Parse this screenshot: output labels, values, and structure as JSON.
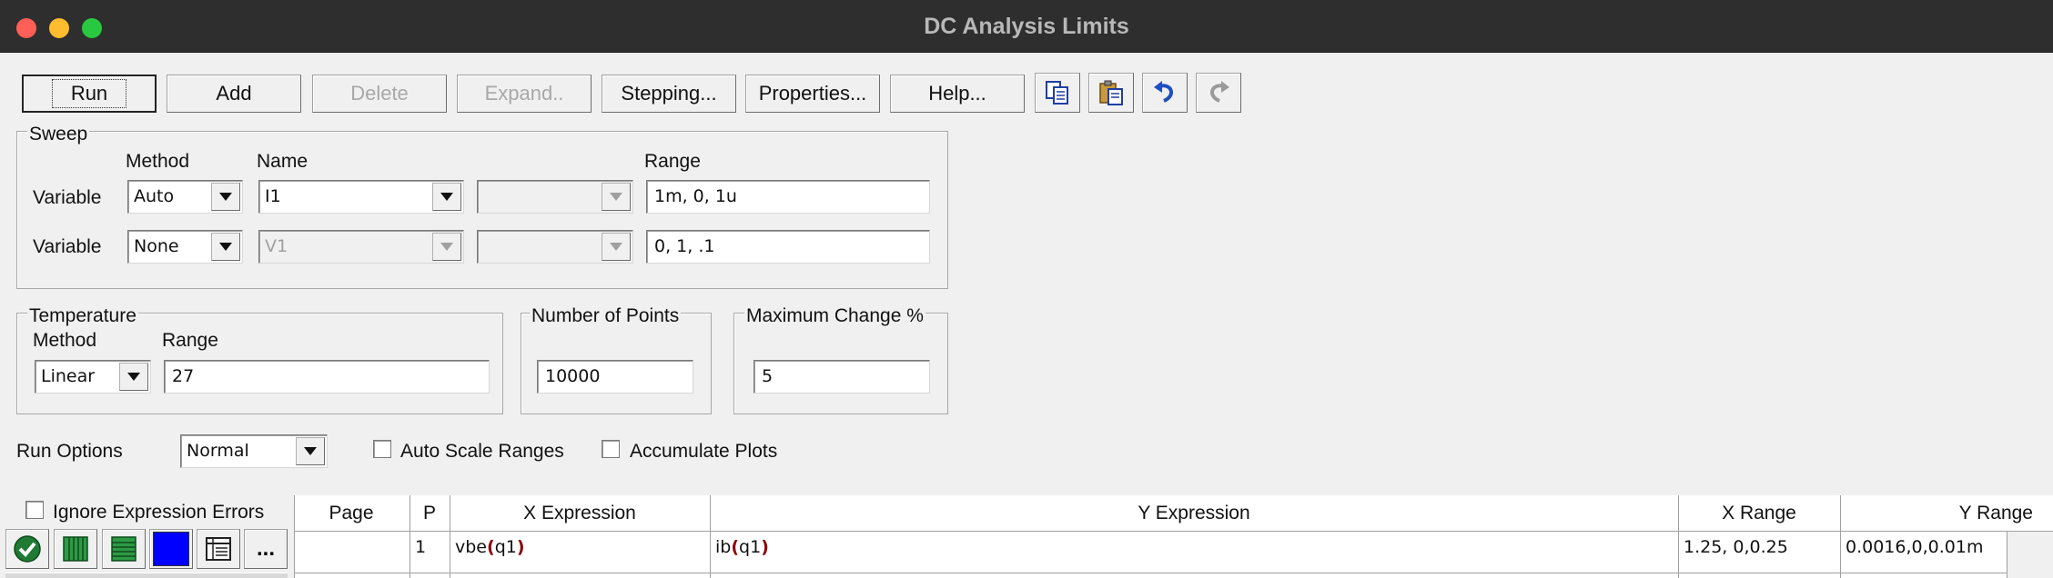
{
  "window": {
    "title": "DC Analysis Limits"
  },
  "toolbar": {
    "run": "Run",
    "add": "Add",
    "delete": "Delete",
    "expand": "Expand..",
    "stepping": "Stepping...",
    "properties": "Properties...",
    "help": "Help..."
  },
  "sweep": {
    "group_label": "Sweep",
    "method_header": "Method",
    "name_header": "Name",
    "range_header": "Range",
    "row1": {
      "label": "Variable",
      "method": "Auto",
      "name": "I1",
      "range": "1m, 0, 1u"
    },
    "row2": {
      "label": "Variable",
      "method": "None",
      "name": "V1",
      "range": "0, 1, .1"
    }
  },
  "temperature": {
    "group_label": "Temperature",
    "method_header": "Method",
    "range_header": "Range",
    "method": "Linear",
    "range": "27"
  },
  "points": {
    "group_label": "Number of Points",
    "value": "10000"
  },
  "max_change": {
    "group_label": "Maximum Change %",
    "value": "5"
  },
  "run_options": {
    "label": "Run Options",
    "value": "Normal",
    "auto_scale": "Auto Scale Ranges",
    "accumulate": "Accumulate Plots"
  },
  "ignore_errors": {
    "label": "Ignore Expression Errors"
  },
  "grid": {
    "headers": {
      "page": "Page",
      "p": "P",
      "x_expr": "X Expression",
      "y_expr": "Y Expression",
      "x_range": "X Range",
      "y_range": "Y Range"
    },
    "row1": {
      "page": "",
      "p": "1",
      "x_expr": {
        "fn": "vbe",
        "open": "(",
        "arg": "q1",
        "close": ")"
      },
      "y_expr": {
        "fn": "ib",
        "open": "(",
        "arg": "q1",
        "close": ")"
      },
      "x_range": "1.25, 0,0.25",
      "y_range": "0.0016,0,0.01m"
    },
    "color_button": "#0000ff",
    "more_button": "..."
  },
  "colors": {
    "paren": "#8b0000",
    "titlebar": "#2e2e2e",
    "face": "#f0f0f0"
  }
}
